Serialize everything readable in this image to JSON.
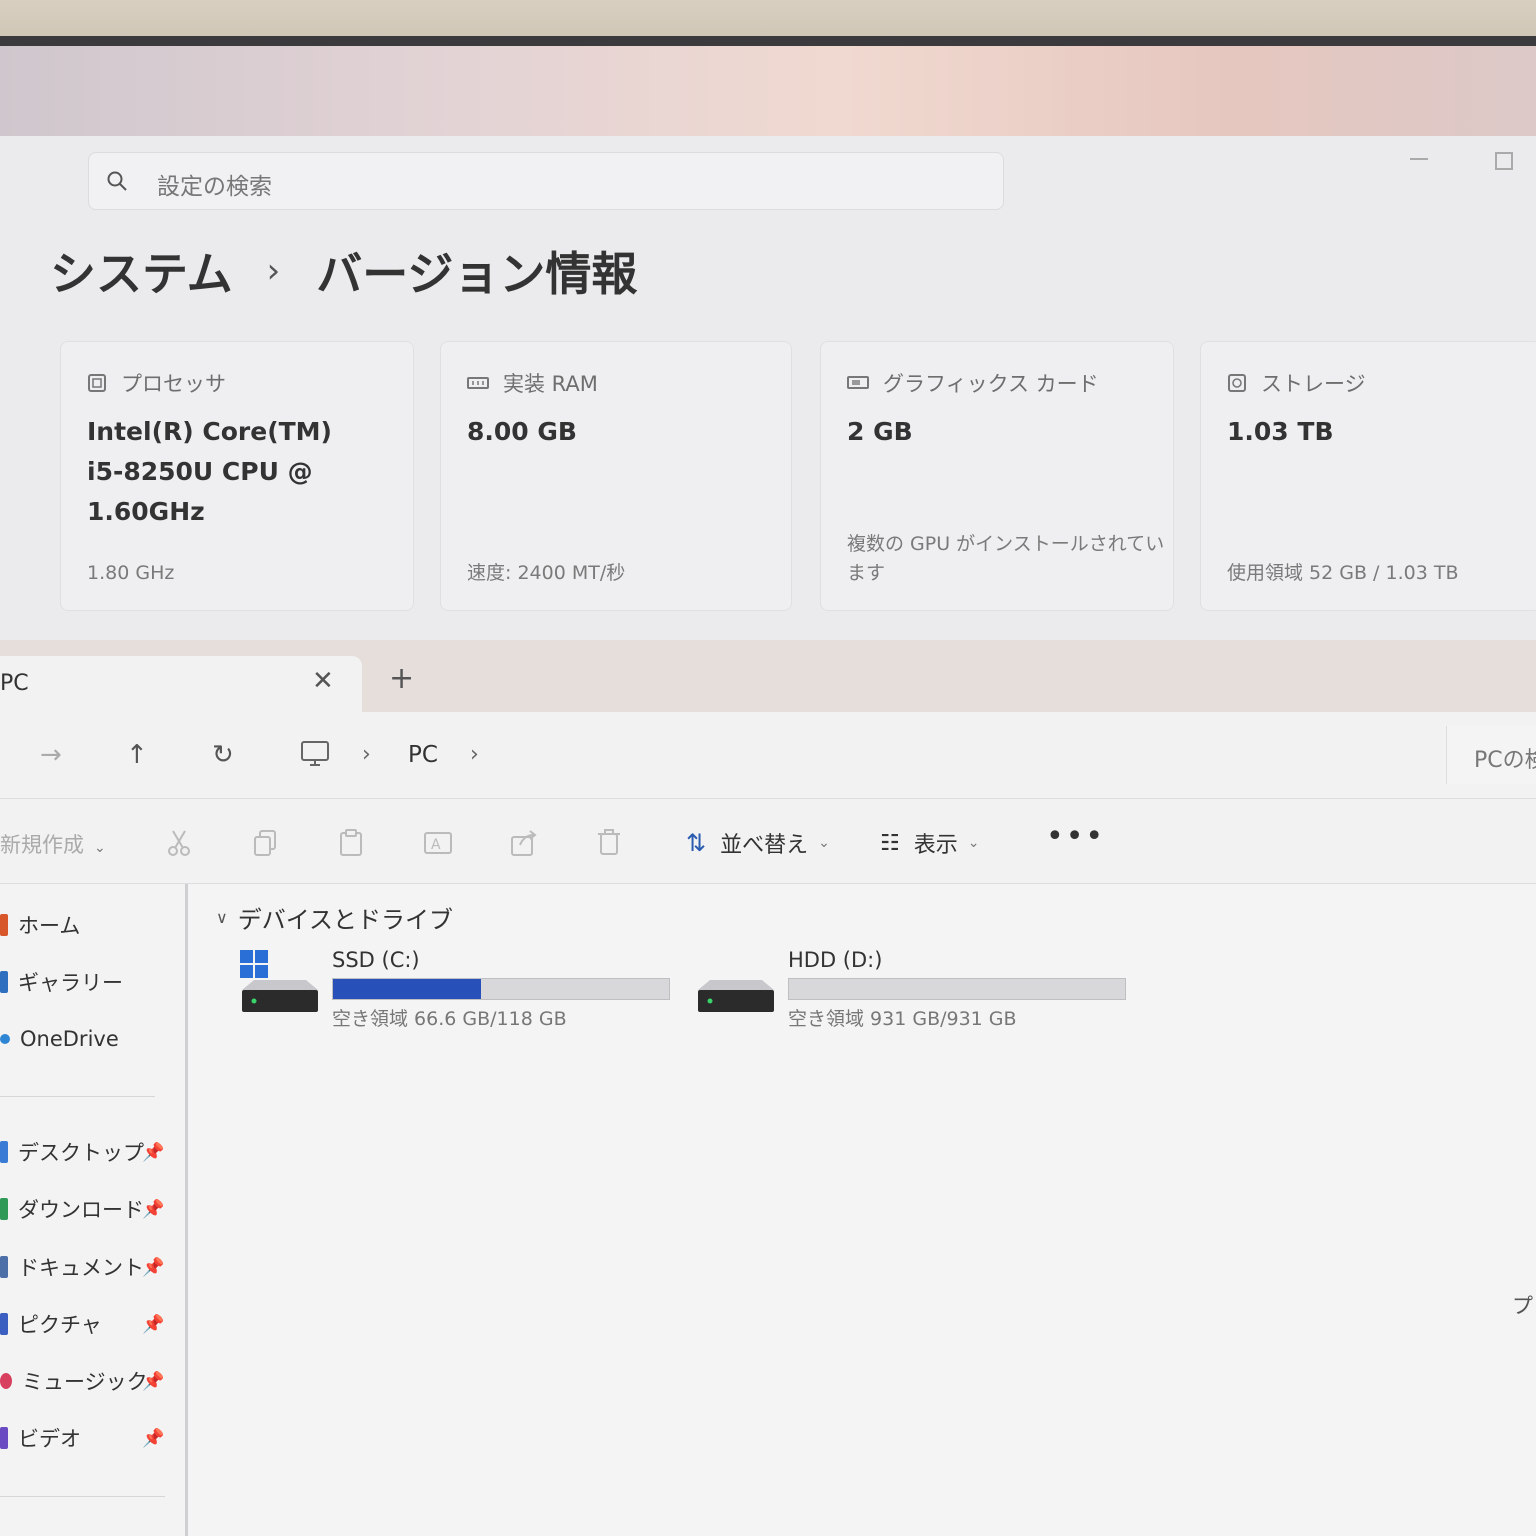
{
  "settings": {
    "search_placeholder": "設定の検索",
    "breadcrumb": {
      "parent": "システム",
      "separator": "›",
      "current": "バージョン情報"
    },
    "cards": [
      {
        "label": "プロセッサ",
        "icon": "processor-icon",
        "value_lines": [
          "Intel(R) Core(TM)",
          "i5-8250U CPU @",
          "1.60GHz"
        ],
        "sub": "1.80 GHz"
      },
      {
        "label": "実装 RAM",
        "icon": "ram-icon",
        "value_lines": [
          "8.00 GB"
        ],
        "sub": "速度: 2400 MT/秒"
      },
      {
        "label": "グラフィックス カード",
        "icon": "graphics-card-icon",
        "value_lines": [
          "2 GB"
        ],
        "sub_lines": [
          "複数の GPU がインストールされてい",
          "ます"
        ]
      },
      {
        "label": "ストレージ",
        "icon": "storage-icon",
        "value_lines": [
          "1.03 TB"
        ],
        "sub": "使用領域 52 GB / 1.03 TB"
      }
    ]
  },
  "explorer": {
    "tab": {
      "title": "PC",
      "close": "✕",
      "add": "+"
    },
    "address": {
      "location": "PC",
      "sep": "›",
      "search_placeholder": "PCの検索"
    },
    "commands": {
      "new": "新規作成",
      "sort": "並べ替え",
      "view": "表示",
      "more": "•••"
    },
    "sidebar": [
      {
        "label": "ホーム",
        "color": "#d8572a"
      },
      {
        "label": "ギャラリー",
        "color": "#2f6fc0"
      },
      {
        "label": "OneDrive",
        "color": "#2f86d4"
      },
      {
        "label": "デスクトップ",
        "color": "#3a7bd5",
        "pinned": true
      },
      {
        "label": "ダウンロード",
        "color": "#2f9a57",
        "pinned": true
      },
      {
        "label": "ドキュメント",
        "color": "#4d6fa8",
        "pinned": true
      },
      {
        "label": "ピクチャ",
        "color": "#3a5fc0",
        "pinned": true
      },
      {
        "label": "ミュージック",
        "color": "#d84060",
        "pinned": true
      },
      {
        "label": "ビデオ",
        "color": "#6b4bc2",
        "pinned": true
      }
    ],
    "group_header": "デバイスとドライブ",
    "drives": [
      {
        "name": "SSD (C:)",
        "used_fraction": 0.44,
        "free": "空き領域 66.6 GB/118 GB",
        "windows_logo": true
      },
      {
        "name": "HDD (D:)",
        "used_fraction": 0.0,
        "free": "空き領域 931 GB/931 GB",
        "windows_logo": false
      }
    ],
    "edge_text": "プ"
  }
}
